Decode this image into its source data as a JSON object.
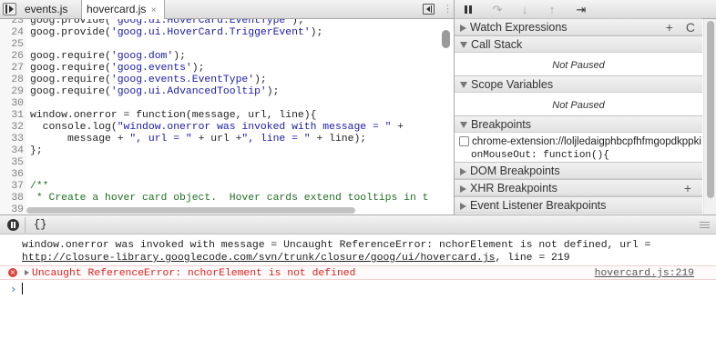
{
  "tabs": {
    "tab1": "events.js",
    "tab2": "hovercard.js",
    "close_glyph": "×"
  },
  "editor": {
    "lines": [
      {
        "num": "23",
        "parts": [
          {
            "t": "goog.provide("
          },
          {
            "t": "'goog.ui.HoverCard.EventType'",
            "c": "str"
          },
          {
            "t": ");"
          }
        ]
      },
      {
        "num": "24",
        "parts": [
          {
            "t": "goog.provide("
          },
          {
            "t": "'goog.ui.HoverCard.TriggerEvent'",
            "c": "str"
          },
          {
            "t": ");"
          }
        ]
      },
      {
        "num": "25",
        "parts": []
      },
      {
        "num": "26",
        "parts": [
          {
            "t": "goog.require("
          },
          {
            "t": "'goog.dom'",
            "c": "str"
          },
          {
            "t": ");"
          }
        ]
      },
      {
        "num": "27",
        "parts": [
          {
            "t": "goog.require("
          },
          {
            "t": "'goog.events'",
            "c": "str"
          },
          {
            "t": ");"
          }
        ]
      },
      {
        "num": "28",
        "parts": [
          {
            "t": "goog.require("
          },
          {
            "t": "'goog.events.EventType'",
            "c": "str"
          },
          {
            "t": ");"
          }
        ]
      },
      {
        "num": "29",
        "parts": [
          {
            "t": "goog.require("
          },
          {
            "t": "'goog.ui.AdvancedTooltip'",
            "c": "str"
          },
          {
            "t": ");"
          }
        ]
      },
      {
        "num": "30",
        "parts": []
      },
      {
        "num": "31",
        "parts": [
          {
            "t": "window.onerror = function(message, url, line){"
          }
        ]
      },
      {
        "num": "32",
        "parts": [
          {
            "t": "  console.log("
          },
          {
            "t": "\"window.onerror was invoked with message = \"",
            "c": "str"
          },
          {
            "t": " +"
          }
        ]
      },
      {
        "num": "33",
        "parts": [
          {
            "t": "      message + "
          },
          {
            "t": "\", url = \"",
            "c": "str"
          },
          {
            "t": " + url +"
          },
          {
            "t": "\", line = \"",
            "c": "str"
          },
          {
            "t": " + line);"
          }
        ]
      },
      {
        "num": "34",
        "parts": [
          {
            "t": "};"
          }
        ]
      },
      {
        "num": "35",
        "parts": []
      },
      {
        "num": "36",
        "parts": []
      },
      {
        "num": "37",
        "parts": [
          {
            "t": "/**",
            "c": "cmt"
          }
        ]
      },
      {
        "num": "38",
        "parts": [
          {
            "t": " * Create a hover card object.  Hover cards extend tooltips in t",
            "c": "cmt"
          }
        ]
      },
      {
        "num": "39",
        "parts": []
      }
    ]
  },
  "sidebar": {
    "watch": "Watch Expressions",
    "watch_add": "+",
    "watch_refresh": "C",
    "call_stack": "Call Stack",
    "call_stack_status": "Not Paused",
    "scope": "Scope Variables",
    "scope_status": "Not Paused",
    "breakpoints": "Breakpoints",
    "bp_source": "chrome-extension://loljledaigphbcpfhfmgopdkppki",
    "bp_code": "onMouseOut: function(){",
    "dom_bp": "DOM Breakpoints",
    "xhr_bp": "XHR Breakpoints",
    "xhr_add": "+",
    "event_bp": "Event Listener Breakpoints"
  },
  "console": {
    "brace_button": "{}",
    "log_line1": "window.onerror was invoked with message = Uncaught ReferenceError: nchorElement is not defined, url =",
    "log_url": "http://closure-library.googlecode.com/svn/trunk/closure/goog/ui/hovercard.js",
    "log_line2_tail": ", line = 219",
    "error_icon": "×",
    "error_text": "Uncaught ReferenceError: nchorElement is not defined",
    "error_link": "hovercard.js:219",
    "prompt": "›"
  },
  "colors": {
    "string": "#1a1aa6",
    "comment": "#236e25",
    "error": "#d22222",
    "prompt": "#2f6fc8"
  }
}
